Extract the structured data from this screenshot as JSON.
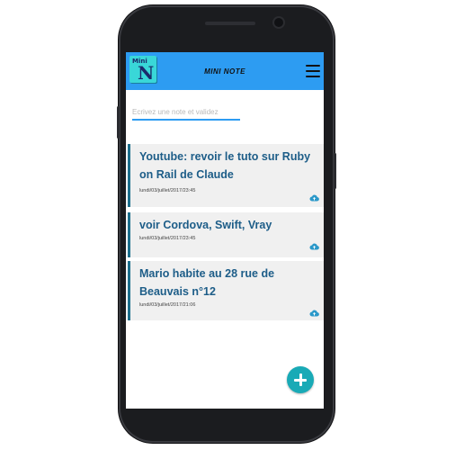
{
  "app": {
    "title": "MINI NOTE",
    "logo_top": "Mini",
    "logo_letter": "N"
  },
  "input": {
    "placeholder": "Ecrivez une note et validez",
    "value": ""
  },
  "notes": [
    {
      "text": "Youtube: revoir le tuto sur Ruby on Rail de Claude",
      "date": "lundi/03/juillet/2017/23:45"
    },
    {
      "text": "voir Cordova, Swift, Vray",
      "date": "lundi/03/juillet/2017/23:45"
    },
    {
      "text": "Mario habite au 28 rue de Beauvais n°12",
      "date": "lundi/03/juillet/2017/21:06"
    }
  ],
  "icons": {
    "menu": "hamburger-menu-icon",
    "sync": "cloud-upload-icon",
    "add": "plus-icon"
  },
  "colors": {
    "appbar": "#2d9cf2",
    "note_text": "#1d5d88",
    "note_border": "#1d6f8c",
    "fab": "#19aab6",
    "card_bg": "#f0f0f0"
  }
}
